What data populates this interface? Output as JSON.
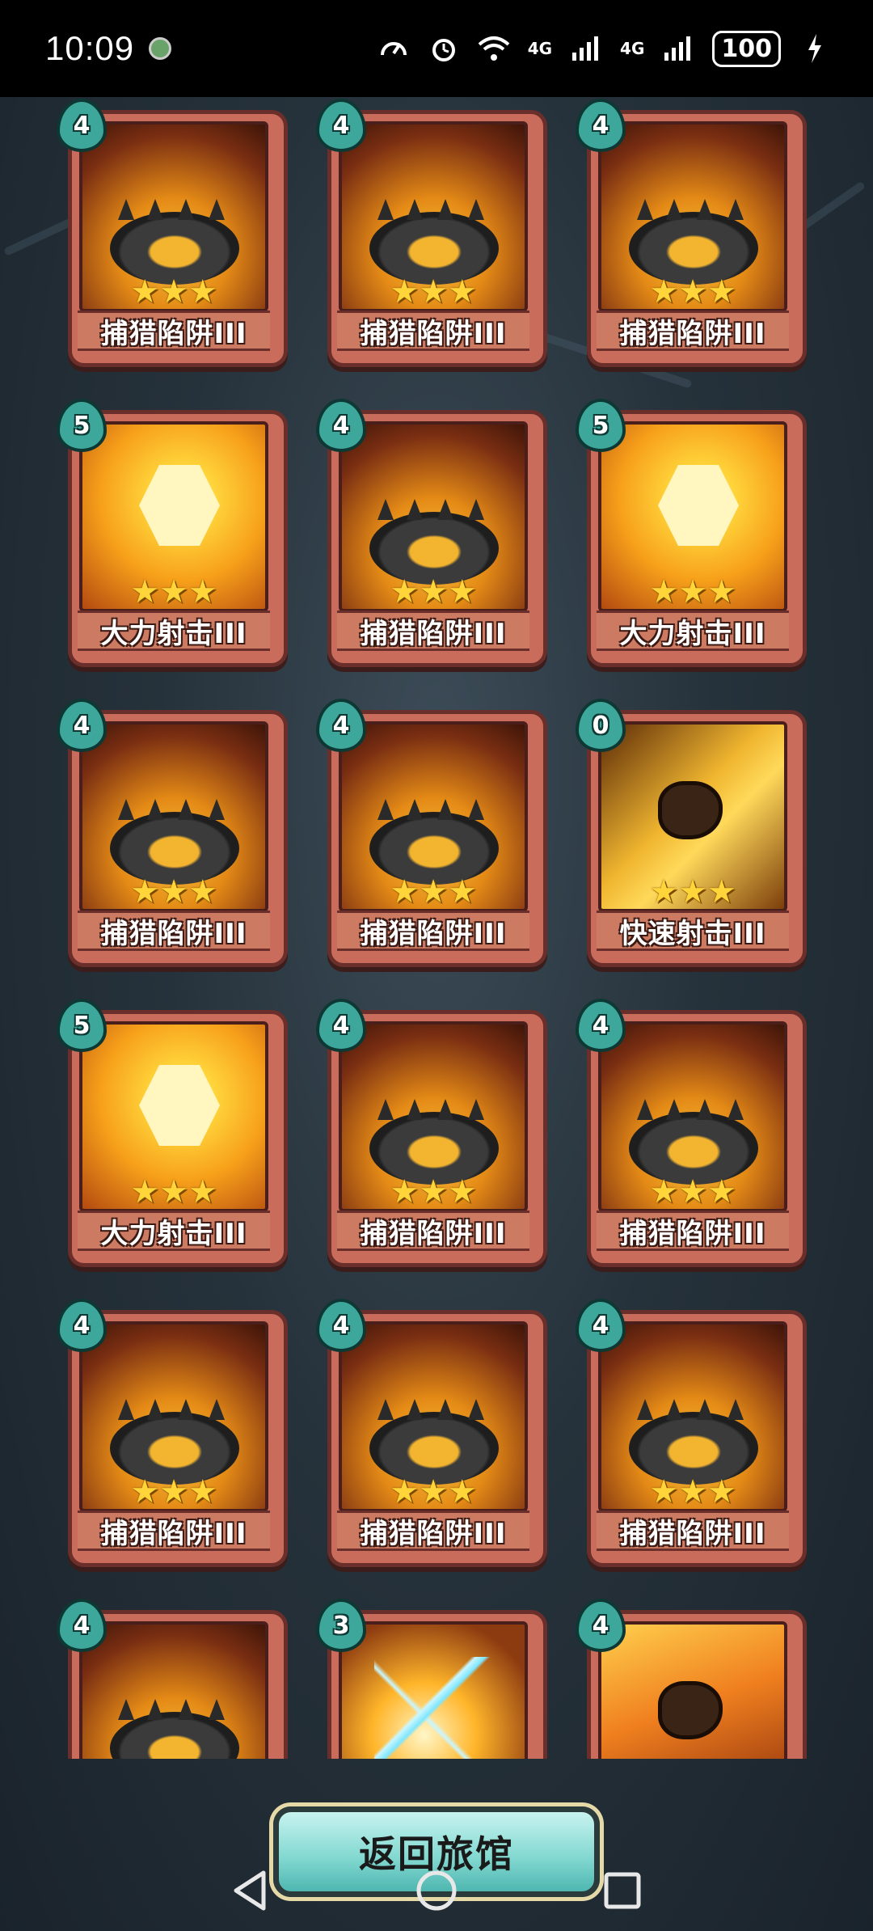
{
  "status_bar": {
    "time": "10:09",
    "network_1": "4G",
    "network_2": "4G",
    "battery": "100"
  },
  "cards": [
    {
      "cost": "4",
      "name": "捕猎陷阱III",
      "art": "trap",
      "stars": "★★★"
    },
    {
      "cost": "4",
      "name": "捕猎陷阱III",
      "art": "trap",
      "stars": "★★★"
    },
    {
      "cost": "4",
      "name": "捕猎陷阱III",
      "art": "trap",
      "stars": "★★★"
    },
    {
      "cost": "5",
      "name": "大力射击III",
      "art": "power",
      "stars": "★★★"
    },
    {
      "cost": "4",
      "name": "捕猎陷阱III",
      "art": "trap",
      "stars": "★★★"
    },
    {
      "cost": "5",
      "name": "大力射击III",
      "art": "power",
      "stars": "★★★"
    },
    {
      "cost": "4",
      "name": "捕猎陷阱III",
      "art": "trap",
      "stars": "★★★"
    },
    {
      "cost": "4",
      "name": "捕猎陷阱III",
      "art": "trap",
      "stars": "★★★"
    },
    {
      "cost": "0",
      "name": "快速射击III",
      "art": "quick",
      "stars": "★★★"
    },
    {
      "cost": "5",
      "name": "大力射击III",
      "art": "power",
      "stars": "★★★"
    },
    {
      "cost": "4",
      "name": "捕猎陷阱III",
      "art": "trap",
      "stars": "★★★"
    },
    {
      "cost": "4",
      "name": "捕猎陷阱III",
      "art": "trap",
      "stars": "★★★"
    },
    {
      "cost": "4",
      "name": "捕猎陷阱III",
      "art": "trap",
      "stars": "★★★"
    },
    {
      "cost": "4",
      "name": "捕猎陷阱III",
      "art": "trap",
      "stars": "★★★"
    },
    {
      "cost": "4",
      "name": "捕猎陷阱III",
      "art": "trap",
      "stars": "★★★"
    },
    {
      "cost": "4",
      "name": "",
      "art": "trap",
      "stars": ""
    },
    {
      "cost": "3",
      "name": "",
      "art": "lightning",
      "stars": ""
    },
    {
      "cost": "4",
      "name": "",
      "art": "rock",
      "stars": ""
    }
  ],
  "return_button": {
    "label": "返回旅馆"
  },
  "colors": {
    "cost_badge": "#3ea79b",
    "card_frame": "#c96c5c",
    "button": "#7fd7cf"
  }
}
